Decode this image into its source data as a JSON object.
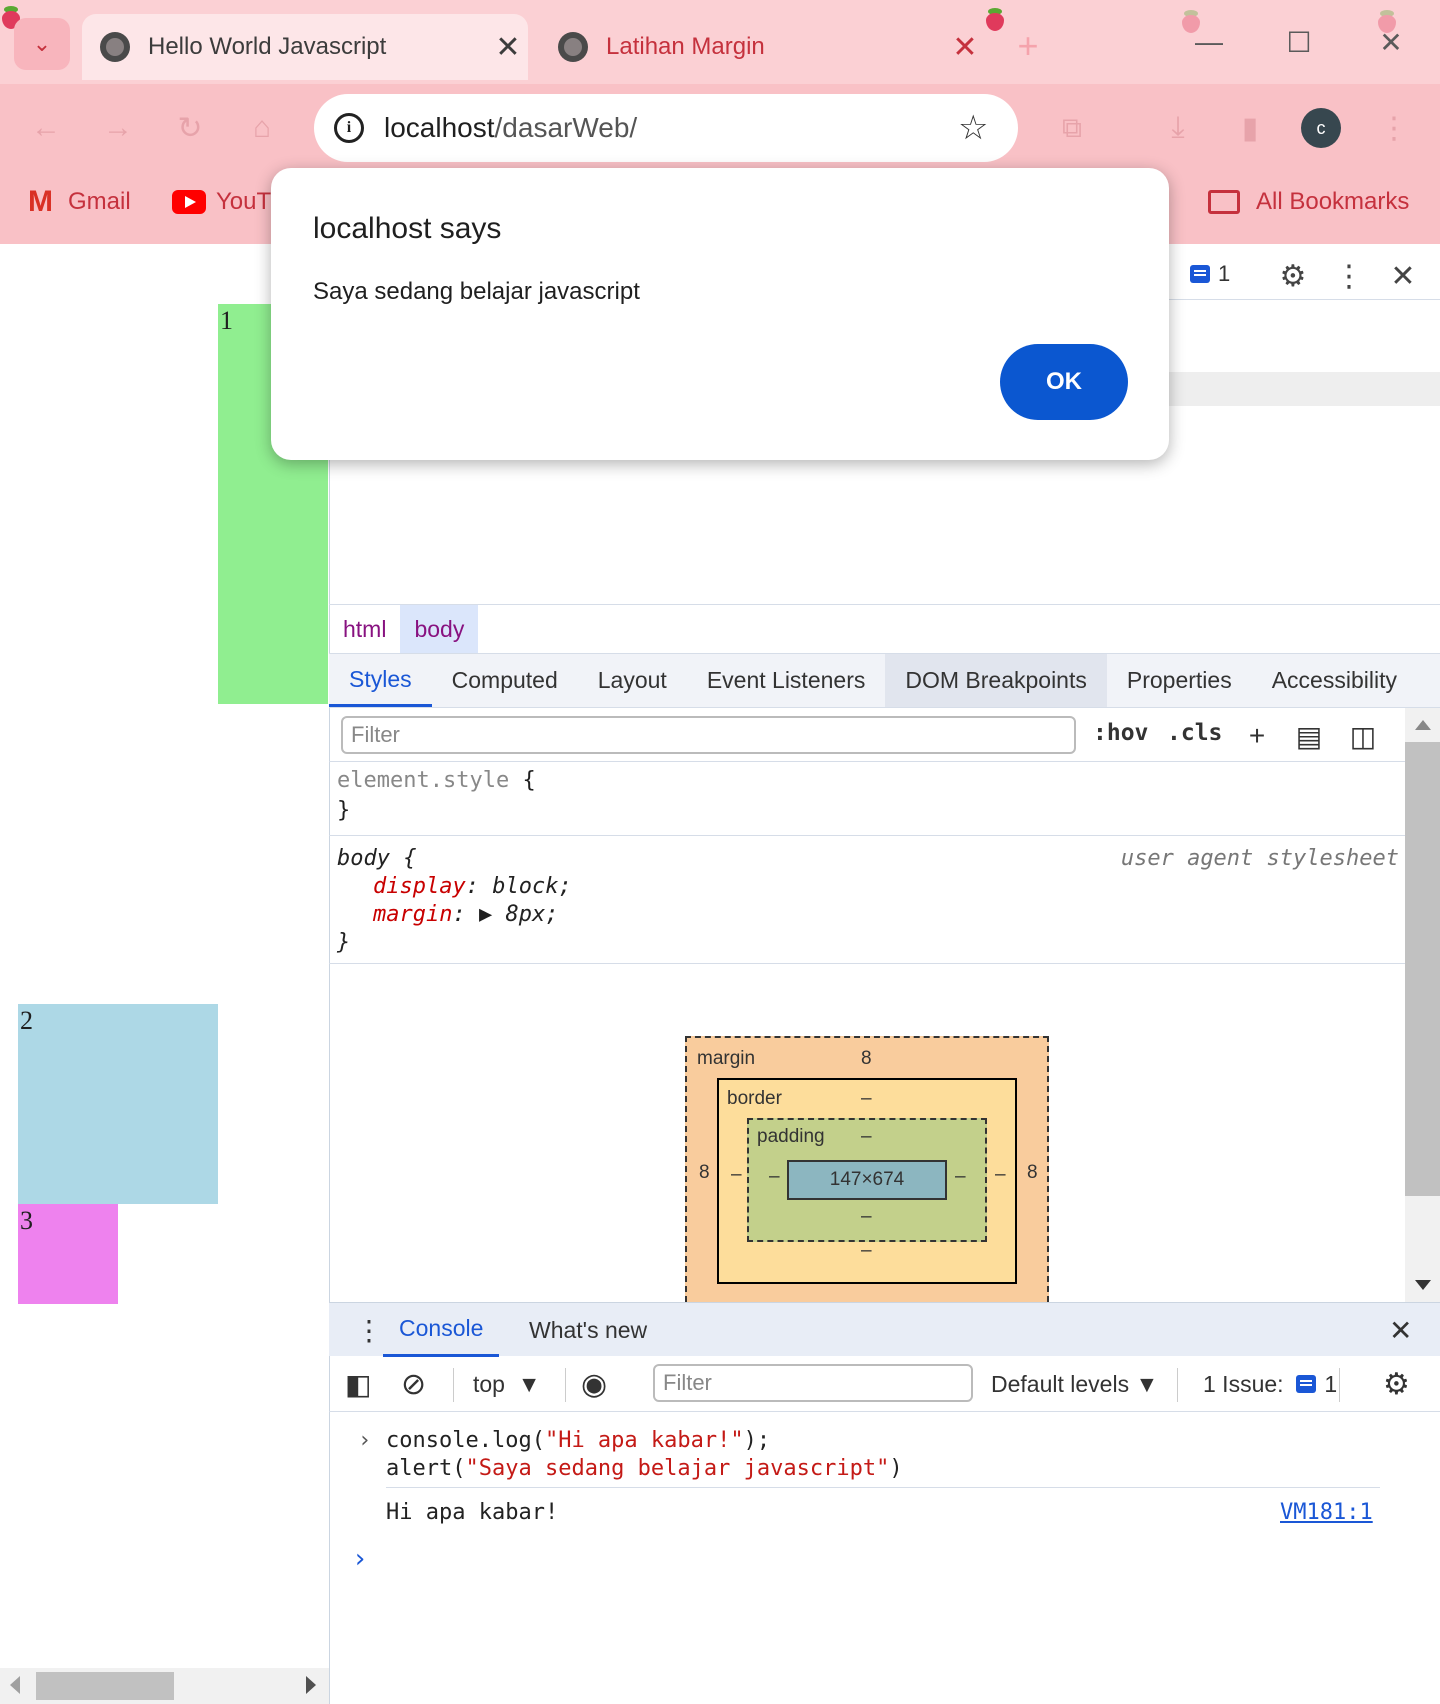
{
  "browser": {
    "tabs": [
      {
        "title": "Hello World Javascript",
        "close": "✕"
      },
      {
        "title": "Latihan Margin",
        "close": "✕"
      }
    ],
    "tab_search_icon": "⌄",
    "new_tab_icon": "+",
    "window_controls": {
      "minimize": "—",
      "maximize": "☐",
      "close": "✕"
    },
    "nav": {
      "back": "←",
      "forward": "→",
      "reload": "↻",
      "home": "⌂"
    },
    "omnibox": {
      "host": "localhost",
      "path": "/dasarWeb/",
      "star": "☆"
    },
    "avatar_letter": "c",
    "bookmarks": [
      {
        "label": "Gmail"
      },
      {
        "label": "YouTu"
      }
    ],
    "all_bookmarks": "All Bookmarks"
  },
  "page": {
    "boxes": [
      {
        "label": "1",
        "color": "#90ee90"
      },
      {
        "label": "2",
        "color": "#add8e6"
      },
      {
        "label": "3",
        "color": "#ee82ee"
      }
    ]
  },
  "alert": {
    "title": "localhost says",
    "message": "Saya sedang belajar javascript",
    "ok": "OK"
  },
  "devtools": {
    "issues_count": "1",
    "breadcrumbs": [
      "html",
      "body"
    ],
    "subtabs": [
      "Styles",
      "Computed",
      "Layout",
      "Event Listeners",
      "DOM Breakpoints",
      "Properties",
      "Accessibility"
    ],
    "styles_filter_placeholder": "Filter",
    "hov": ":hov",
    "cls": ".cls",
    "element_style": {
      "selector": "element.style",
      "open": "{",
      "close": "}"
    },
    "body_rule": {
      "selector": "body",
      "open": "{",
      "close": "}",
      "source": "user agent stylesheet",
      "declarations": [
        {
          "prop": "display",
          "value": "block;"
        },
        {
          "prop": "margin",
          "value": "8px;"
        }
      ]
    },
    "box_model": {
      "margin_label": "margin",
      "margin_top": "8",
      "margin_left": "8",
      "margin_right": "8",
      "border_label": "border",
      "border_top": "–",
      "border_left": "–",
      "border_right": "–",
      "border_bottom": "–",
      "padding_label": "padding",
      "padding_top": "–",
      "padding_left": "–",
      "padding_right": "–",
      "padding_bottom": "–",
      "content": "147×674"
    },
    "drawer": {
      "tabs": [
        "Console",
        "What's new"
      ],
      "context": "top",
      "filter_placeholder": "Filter",
      "levels": "Default levels",
      "issue_label": "1 Issue:",
      "issue_count": "1"
    },
    "console": {
      "input_line1_fn": "console.log(",
      "input_line1_str": "\"Hi apa kabar!\"",
      "input_line1_end": ");",
      "input_line2_fn": "alert(",
      "input_line2_str": "\"Saya sedang belajar javascript\"",
      "input_line2_end": ")",
      "output": "Hi apa kabar!",
      "source_link": "VM181:1"
    }
  },
  "colors": {
    "accent": "#1a57d6",
    "ok_button": "#0b57d0",
    "tab_strip": "#fbd0d4",
    "toolbar": "#f9c1c6"
  }
}
